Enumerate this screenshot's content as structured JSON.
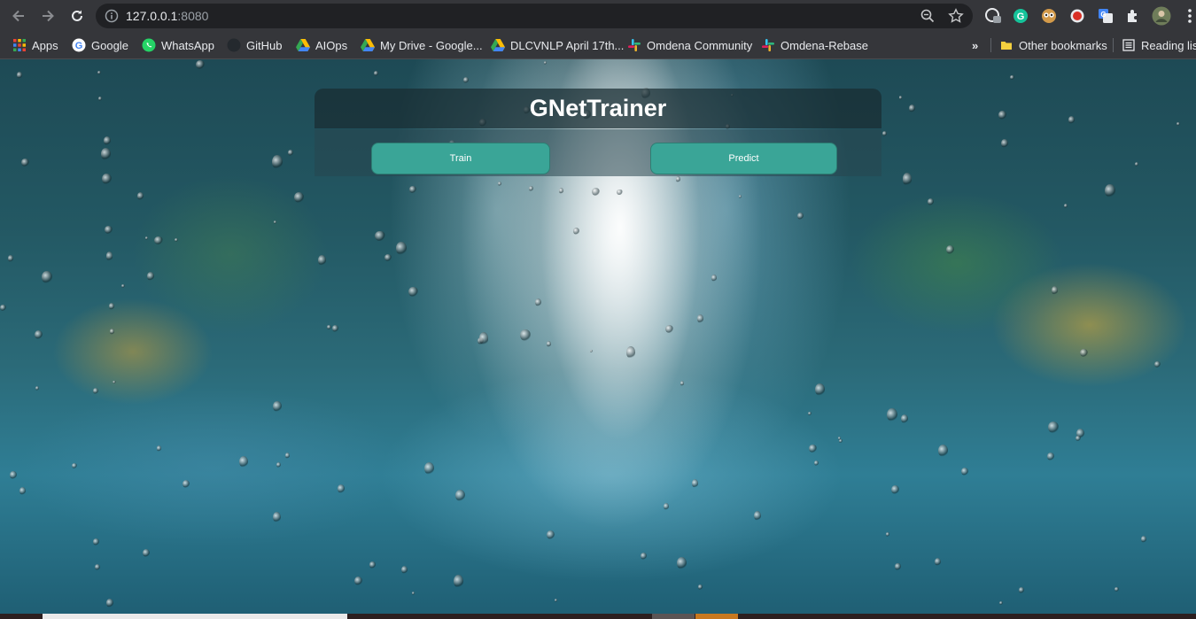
{
  "browser": {
    "url_host": "127.0.0.1",
    "url_port": ":8080",
    "bookmarks": [
      {
        "label": "Apps",
        "icon": "apps-grid-icon"
      },
      {
        "label": "Google",
        "icon": "google-icon"
      },
      {
        "label": "WhatsApp",
        "icon": "whatsapp-icon"
      },
      {
        "label": "GitHub",
        "icon": "github-icon"
      },
      {
        "label": "AIOps",
        "icon": "google-drive-icon"
      },
      {
        "label": "My Drive - Google...",
        "icon": "google-drive-icon"
      },
      {
        "label": "DLCVNLP April 17th...",
        "icon": "google-drive-icon"
      },
      {
        "label": "Omdena Community",
        "icon": "slack-icon"
      },
      {
        "label": "Omdena-Rebase",
        "icon": "slack-icon"
      }
    ],
    "overflow_label": "»",
    "other_bookmarks": "Other bookmarks",
    "reading_list": "Reading list"
  },
  "app": {
    "title": "GNetTrainer",
    "train_label": "Train",
    "predict_label": "Predict",
    "accent_color": "#3aa597"
  }
}
